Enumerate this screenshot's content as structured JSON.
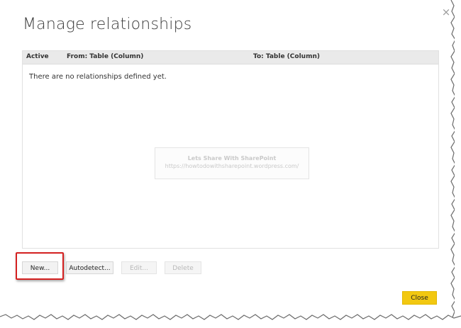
{
  "dialog": {
    "title": "Manage relationships",
    "close_glyph": "×"
  },
  "table": {
    "columns": [
      "Active",
      "From: Table (Column)",
      "To: Table (Column)"
    ],
    "empty_message": "There are no relationships defined yet."
  },
  "watermark": {
    "line1": "Lets Share With SharePoint",
    "line2": "https://howtodowithsharepoint.wordpress.com/"
  },
  "buttons": {
    "new": "New...",
    "autodetect": "Autodetect...",
    "edit": "Edit...",
    "delete": "Delete",
    "close": "Close"
  },
  "colors": {
    "accent": "#f2c811",
    "highlight": "#d42020",
    "header_bg": "#eaeaea"
  },
  "icons": {
    "close": "close-icon"
  }
}
